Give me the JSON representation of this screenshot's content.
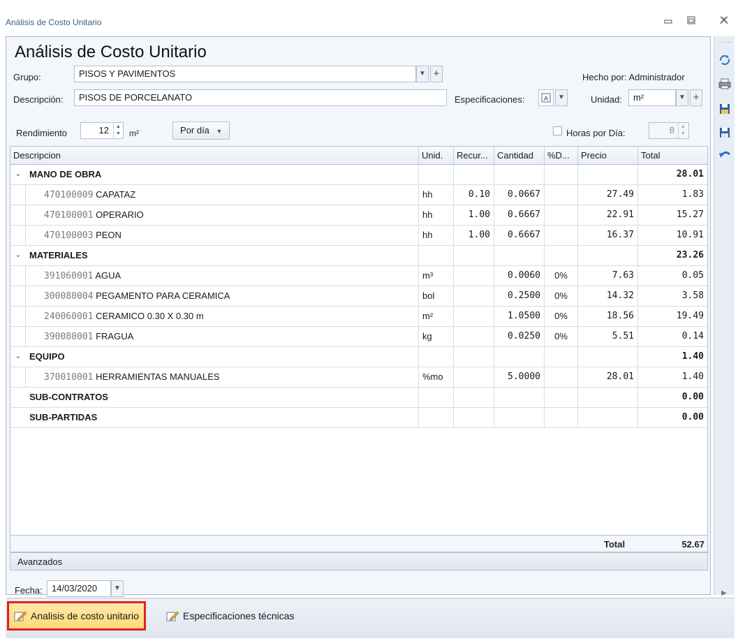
{
  "window": {
    "title": "Análisis de Costo Unitario",
    "controls": [
      "minimize",
      "restore",
      "close"
    ]
  },
  "form": {
    "heading": "Análisis de Costo Unitario",
    "grupo_label": "Grupo:",
    "grupo_value": "PISOS Y PAVIMENTOS",
    "hecho_por": "Hecho por: Administrador",
    "descripcion_label": "Descripción:",
    "descripcion_value": "PISOS DE PORCELANATO",
    "especificaciones_label": "Especificaciones:",
    "unidad_label": "Unidad:",
    "unidad_value": "m²",
    "rendimiento_label": "Rendimiento",
    "rendimiento_value": "12",
    "rendimiento_unit": "m²",
    "periodo": "Por día",
    "horas_label": "Horas por Día:",
    "horas_value": "8",
    "horas_checked": false
  },
  "grid": {
    "columns": [
      "Descripcion",
      "Unid.",
      "Recur...",
      "Cantidad",
      "%D...",
      "Precio",
      "Total"
    ],
    "groups": [
      {
        "name": "MANO DE OBRA",
        "total": "28.01",
        "expandable": true,
        "items": [
          {
            "code": "470100009",
            "desc": "CAPATAZ",
            "unit": "hh",
            "recur": "0.10",
            "cant": "0.0667",
            "pct": "",
            "precio": "27.49",
            "total": "1.83"
          },
          {
            "code": "470100001",
            "desc": "OPERARIO",
            "unit": "hh",
            "recur": "1.00",
            "cant": "0.6667",
            "pct": "",
            "precio": "22.91",
            "total": "15.27"
          },
          {
            "code": "470100003",
            "desc": "PEON",
            "unit": "hh",
            "recur": "1.00",
            "cant": "0.6667",
            "pct": "",
            "precio": "16.37",
            "total": "10.91"
          }
        ]
      },
      {
        "name": "MATERIALES",
        "total": "23.26",
        "expandable": true,
        "items": [
          {
            "code": "391060001",
            "desc": "AGUA",
            "unit": "m³",
            "recur": "",
            "cant": "0.0060",
            "pct": "0%",
            "precio": "7.63",
            "total": "0.05"
          },
          {
            "code": "300080004",
            "desc": "PEGAMENTO PARA CERAMICA",
            "unit": "bol",
            "recur": "",
            "cant": "0.2500",
            "pct": "0%",
            "precio": "14.32",
            "total": "3.58"
          },
          {
            "code": "240060001",
            "desc": "CERAMICO 0.30 X 0.30 m",
            "unit": "m²",
            "recur": "",
            "cant": "1.0500",
            "pct": "0%",
            "precio": "18.56",
            "total": "19.49"
          },
          {
            "code": "390080001",
            "desc": "FRAGUA",
            "unit": "kg",
            "recur": "",
            "cant": "0.0250",
            "pct": "0%",
            "precio": "5.51",
            "total": "0.14"
          }
        ]
      },
      {
        "name": "EQUIPO",
        "total": "1.40",
        "expandable": true,
        "items": [
          {
            "code": "370010001",
            "desc": "HERRAMIENTAS MANUALES",
            "unit": "%mo",
            "recur": "",
            "cant": "5.0000",
            "pct": "",
            "precio": "28.01",
            "total": "1.40"
          }
        ]
      },
      {
        "name": "SUB-CONTRATOS",
        "total": "0.00",
        "expandable": false,
        "items": []
      },
      {
        "name": "SUB-PARTIDAS",
        "total": "0.00",
        "expandable": false,
        "items": []
      }
    ],
    "footer_label": "Total",
    "footer_total": "52.67"
  },
  "advanced": {
    "header": "Avanzados",
    "fecha_label": "Fecha:",
    "fecha_value": "14/03/2020"
  },
  "tabs": [
    {
      "label": "Analisis de costo unitario",
      "active": true
    },
    {
      "label": "Especificaciones técnicas",
      "active": false
    }
  ],
  "toolbar_icons": [
    "refresh-icon",
    "print-icon",
    "save-as-icon",
    "save-icon",
    "undo-icon"
  ]
}
